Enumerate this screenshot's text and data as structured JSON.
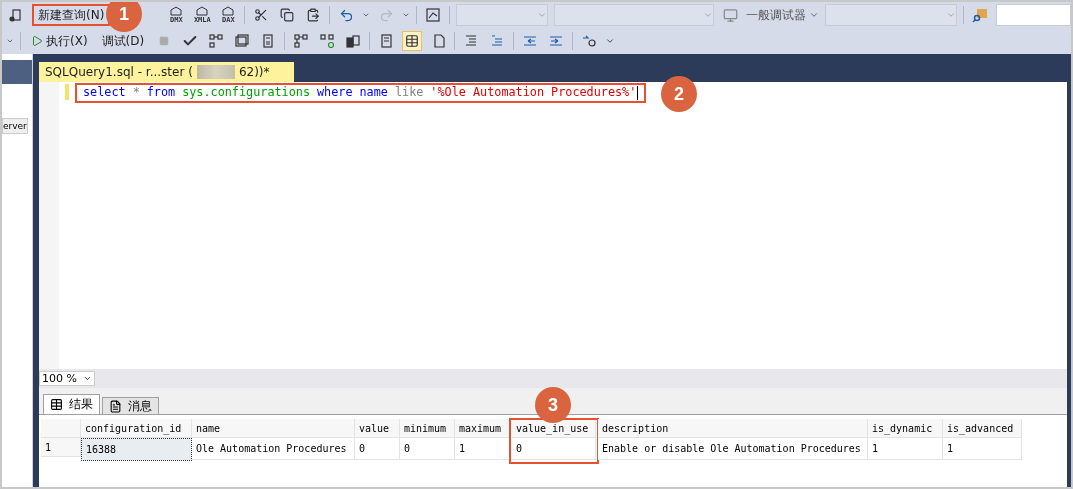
{
  "toolbar": {
    "new_query": {
      "label": "新建查询(N)",
      "annotated": true
    },
    "query_icons": [
      "DMX",
      "XMLA",
      "DAX"
    ],
    "debugger": {
      "label": "一般调试器"
    },
    "execute": {
      "label": "执行(X)"
    },
    "debug": {
      "label": "调试(D)"
    }
  },
  "side_panel": {
    "text": "erver"
  },
  "document_tab": {
    "title_start": "SQLQuery1.sql - r...ster (",
    "title_end": "62))*",
    "selected": true
  },
  "editor": {
    "annotated": true,
    "tokens": [
      {
        "text": "select",
        "kind": "keyword"
      },
      {
        "text": "*",
        "kind": "operator"
      },
      {
        "text": "from",
        "kind": "keyword"
      },
      {
        "text": "sys.configurations",
        "kind": "system"
      },
      {
        "text": "where",
        "kind": "keyword"
      },
      {
        "text": "name",
        "kind": "keyword"
      },
      {
        "text": "like",
        "kind": "operator"
      },
      {
        "text": "'%Ole Automation Procedures%'",
        "kind": "string"
      }
    ]
  },
  "zoom": {
    "value": "100 %"
  },
  "result_tabs": [
    {
      "label": "结果",
      "selected": true
    },
    {
      "label": "消息",
      "selected": false
    }
  ],
  "grid": {
    "columns": [
      {
        "name": "configuration_id",
        "annotated": false
      },
      {
        "name": "name",
        "annotated": false
      },
      {
        "name": "value",
        "annotated": false
      },
      {
        "name": "minimum",
        "annotated": false
      },
      {
        "name": "maximum",
        "annotated": false
      },
      {
        "name": "value_in_use",
        "annotated": true
      },
      {
        "name": "description",
        "annotated": false
      },
      {
        "name": "is_dynamic",
        "annotated": false
      },
      {
        "name": "is_advanced",
        "annotated": false
      }
    ],
    "rows": [
      {
        "number": "1",
        "cells": [
          "16388",
          "Ole Automation Procedures",
          "0",
          "0",
          "1",
          "0",
          "Enable or disable Ole Automation Procedures",
          "1",
          "1"
        ]
      }
    ]
  },
  "callouts": [
    "1",
    "2",
    "3"
  ]
}
